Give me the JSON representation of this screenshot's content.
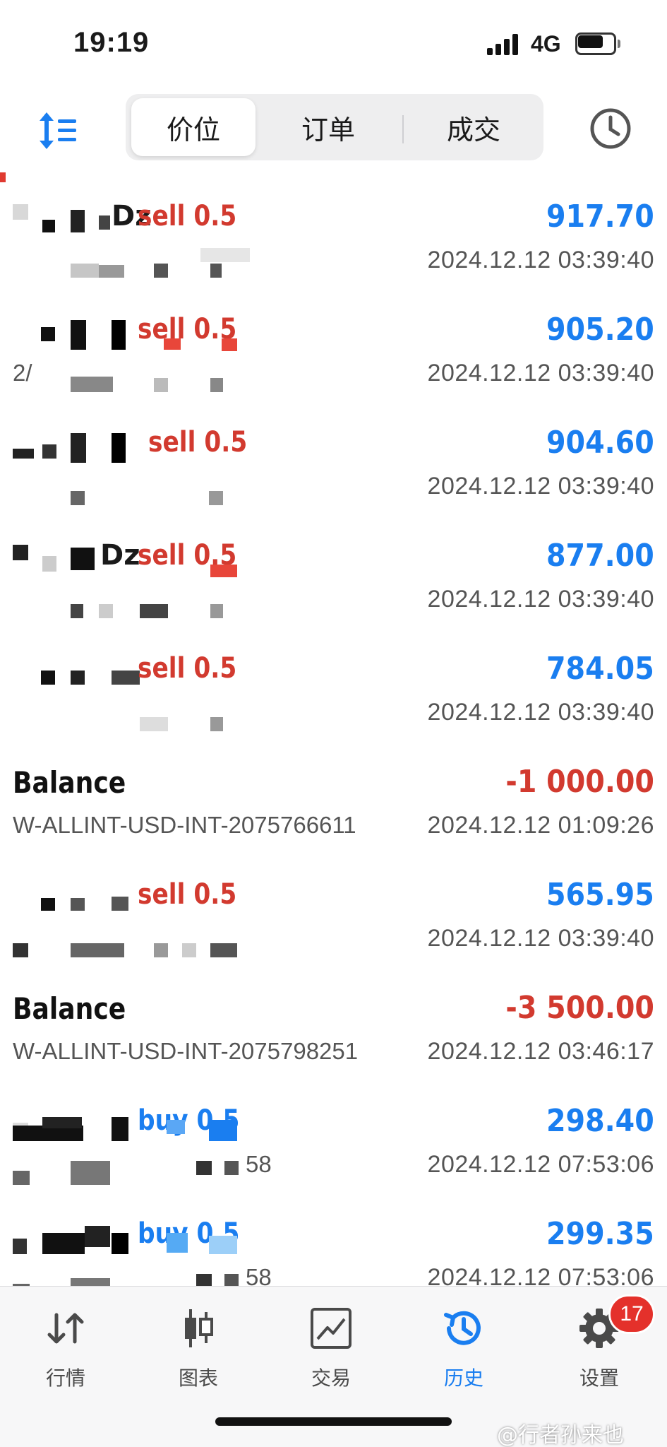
{
  "status_bar": {
    "time": "19:19",
    "network": "4G",
    "battery_level": 0.7
  },
  "header": {
    "tabs": [
      {
        "label": "价位",
        "active": true
      },
      {
        "label": "订单",
        "active": false
      },
      {
        "label": "成交",
        "active": false
      }
    ]
  },
  "deals": [
    {
      "kind": "trade",
      "symbol_fragment": "Dz",
      "type": "sell 0.5",
      "direction": "sell",
      "amount": "917.70",
      "time": "2024.12.12 03:39:40",
      "comment_fragment": ""
    },
    {
      "kind": "trade",
      "symbol_fragment": "",
      "type": "sell 0.5",
      "direction": "sell",
      "amount": "905.20",
      "time": "2024.12.12 03:39:40",
      "comment_fragment": "2/"
    },
    {
      "kind": "trade",
      "symbol_fragment": "",
      "type": "sell 0.5",
      "direction": "sell",
      "amount": "904.60",
      "time": "2024.12.12 03:39:40",
      "comment_fragment": ""
    },
    {
      "kind": "trade",
      "symbol_fragment": "Dz",
      "type": "sell 0.5",
      "direction": "sell",
      "amount": "877.00",
      "time": "2024.12.12 03:39:40",
      "comment_fragment": ""
    },
    {
      "kind": "trade",
      "symbol_fragment": "",
      "type": "sell 0.5",
      "direction": "sell",
      "amount": "784.05",
      "time": "2024.12.12 03:39:40",
      "comment_fragment": ""
    },
    {
      "kind": "balance",
      "title": "Balance",
      "amount": "-1 000.00",
      "time": "2024.12.12 01:09:26",
      "comment": "W-ALLINT-USD-INT-2075766611"
    },
    {
      "kind": "trade",
      "symbol_fragment": "",
      "type": "sell 0.5",
      "direction": "sell",
      "amount": "565.95",
      "time": "2024.12.12 03:39:40",
      "comment_fragment": ""
    },
    {
      "kind": "balance",
      "title": "Balance",
      "amount": "-3 500.00",
      "time": "2024.12.12 03:46:17",
      "comment": "W-ALLINT-USD-INT-2075798251"
    },
    {
      "kind": "trade",
      "symbol_fragment": "",
      "type": "buy 0.5",
      "direction": "buy",
      "amount": "298.40",
      "time": "2024.12.12 07:53:06",
      "comment_fragment": "58"
    },
    {
      "kind": "trade",
      "symbol_fragment": "",
      "type": "buy 0.5",
      "direction": "buy",
      "amount": "299.35",
      "time": "2024.12.12 07:53:06",
      "comment_fragment": "58"
    }
  ],
  "tabbar": {
    "items": [
      {
        "label": "行情",
        "icon": "quotes-arrows-icon",
        "active": false
      },
      {
        "label": "图表",
        "icon": "candlestick-chart-icon",
        "active": false
      },
      {
        "label": "交易",
        "icon": "trade-chart-icon",
        "active": false
      },
      {
        "label": "历史",
        "icon": "history-clock-icon",
        "active": true
      },
      {
        "label": "设置",
        "icon": "settings-gear-icon",
        "active": false
      }
    ],
    "settings_badge": "17"
  },
  "watermark": "@行者孙来也",
  "colors": {
    "accent": "#1a7ef0",
    "negative": "#d23a2f",
    "badge": "#e4312b"
  }
}
